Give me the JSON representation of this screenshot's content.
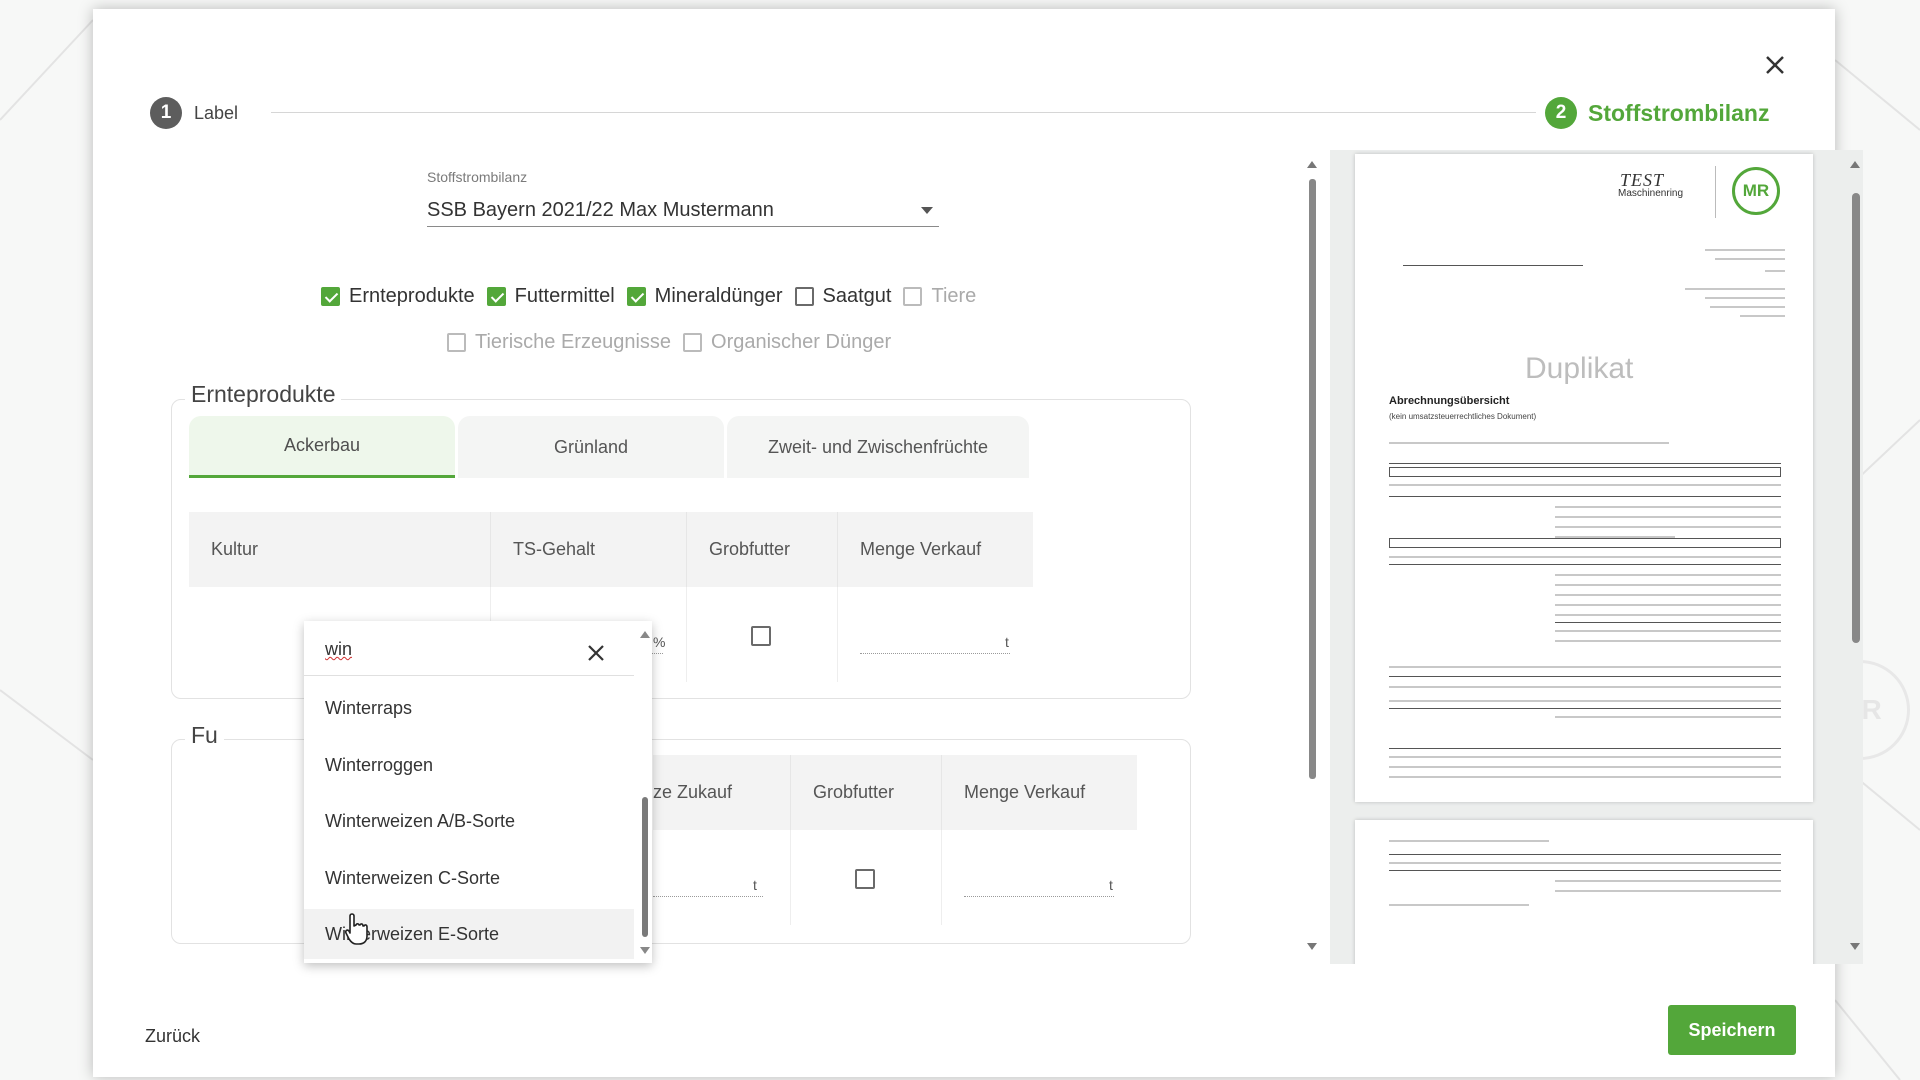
{
  "stepper": {
    "step1": {
      "number": "1",
      "label": "Label"
    },
    "step2": {
      "number": "2",
      "label": "Stoffstrombilanz"
    }
  },
  "select": {
    "label": "Stoffstrombilanz",
    "value": "SSB Bayern 2021/22 Max Mustermann"
  },
  "checkboxes": [
    {
      "label": "Ernteprodukte",
      "checked": true
    },
    {
      "label": "Futtermittel",
      "checked": true
    },
    {
      "label": "Mineraldünger",
      "checked": true
    },
    {
      "label": "Saatgut",
      "checked": false
    },
    {
      "label": "Tiere",
      "checked": false,
      "disabled": true
    },
    {
      "label": "Tierische Erzeugnisse",
      "checked": false,
      "disabled": true
    },
    {
      "label": "Organischer Dünger",
      "checked": false,
      "disabled": true
    }
  ],
  "section1": {
    "title": "Ernteprodukte",
    "tabs": [
      "Ackerbau",
      "Grünland",
      "Zweit- und Zwischenfrüchte"
    ],
    "columns": [
      "Kultur",
      "TS-Gehalt",
      "Grobfutter",
      "Menge Verkauf"
    ],
    "units": {
      "ts": "%",
      "menge": "t"
    }
  },
  "section2": {
    "title_visible": "Fu",
    "columns": [
      "ze Zukauf",
      "Grobfutter",
      "Menge Verkauf"
    ],
    "units": {
      "zukauf": "t",
      "menge": "t"
    }
  },
  "dropdown": {
    "search": "win",
    "items": [
      "Winterraps",
      "Winterroggen",
      "Winterweizen A/B-Sorte",
      "Winterweizen C-Sorte",
      "Winterweizen E-Sorte"
    ],
    "hovered_index": 4
  },
  "preview": {
    "watermark": "Duplikat",
    "logo_text": "TEST",
    "logo_subtext": "Maschinenring",
    "mr_badge": "MR",
    "doc_title": "Abrechnungsübersicht",
    "doc_subtitle": "(kein umsatzsteuerrechtliches Dokument)"
  },
  "footer": {
    "back": "Zurück",
    "save": "Speichern"
  },
  "colors": {
    "accent": "#53a73a",
    "step_inactive": "#5d5d5d"
  },
  "background": {
    "badge": "MR"
  }
}
